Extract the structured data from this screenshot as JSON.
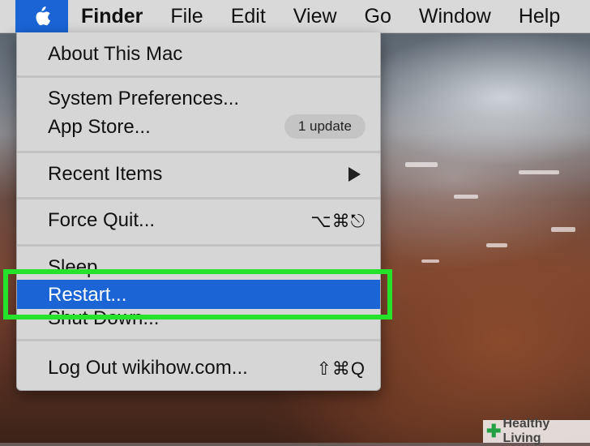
{
  "menubar": {
    "apple_icon": "apple-logo-icon",
    "items": [
      "Finder",
      "File",
      "Edit",
      "View",
      "Go",
      "Window",
      "Help"
    ]
  },
  "apple_menu": {
    "about": "About This Mac",
    "system_preferences": "System Preferences...",
    "app_store": "App Store...",
    "app_store_badge": "1 update",
    "recent_items": "Recent Items",
    "force_quit": "Force Quit...",
    "force_quit_shortcut": "⌥⌘⎋",
    "sleep": "Sleep",
    "restart": "Restart...",
    "shut_down": "Shut Down...",
    "log_out": "Log Out wikihow.com...",
    "log_out_shortcut": "⇧⌘Q"
  },
  "colors": {
    "highlight": "#1a64d6",
    "callout": "#25e22a"
  },
  "watermark": "Healthy Living"
}
